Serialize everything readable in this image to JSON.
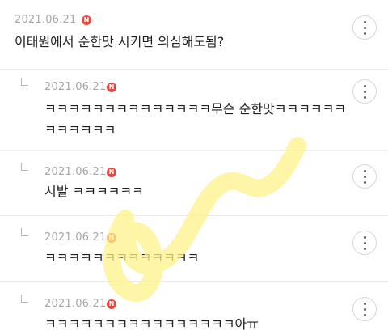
{
  "comments": [
    {
      "date": "2021.06.21",
      "badge": "N",
      "text": "이태원에서 순한맛 시키면 의심해도됨?",
      "is_reply": false
    },
    {
      "date": "2021.06.21",
      "badge": "N",
      "text": "ㅋㅋㅋㅋㅋㅋㅋㅋㅋㅋㅋㅋㅋㅋ무슨 순한맛ㅋㅋㅋㅋㅋㅋ\nㅋㅋㅋㅋㅋㅋ",
      "is_reply": true
    },
    {
      "date": "2021.06.21",
      "badge": "N",
      "text": "시발 ㅋㅋㅋㅋㅋㅋ",
      "is_reply": true
    },
    {
      "date": "2021.06.21",
      "badge": "N",
      "text": "ㅋㅋㅋㅋㅋㅋㅋㅋㅋㅋㅋㅋㅋ",
      "is_reply": true
    },
    {
      "date": "2021.06.21",
      "badge": "N",
      "text": "ㅋㅋㅋㅋㅋㅋㅋㅋㅋㅋㅋㅋㅋㅋㅋㅋ아ㅠ",
      "is_reply": true
    }
  ],
  "more_icon": "more-vertical-icon",
  "colors": {
    "badge": "#e8463e",
    "date": "#a7a7a7",
    "divider": "#ececec",
    "highlight": "#fff28a"
  }
}
